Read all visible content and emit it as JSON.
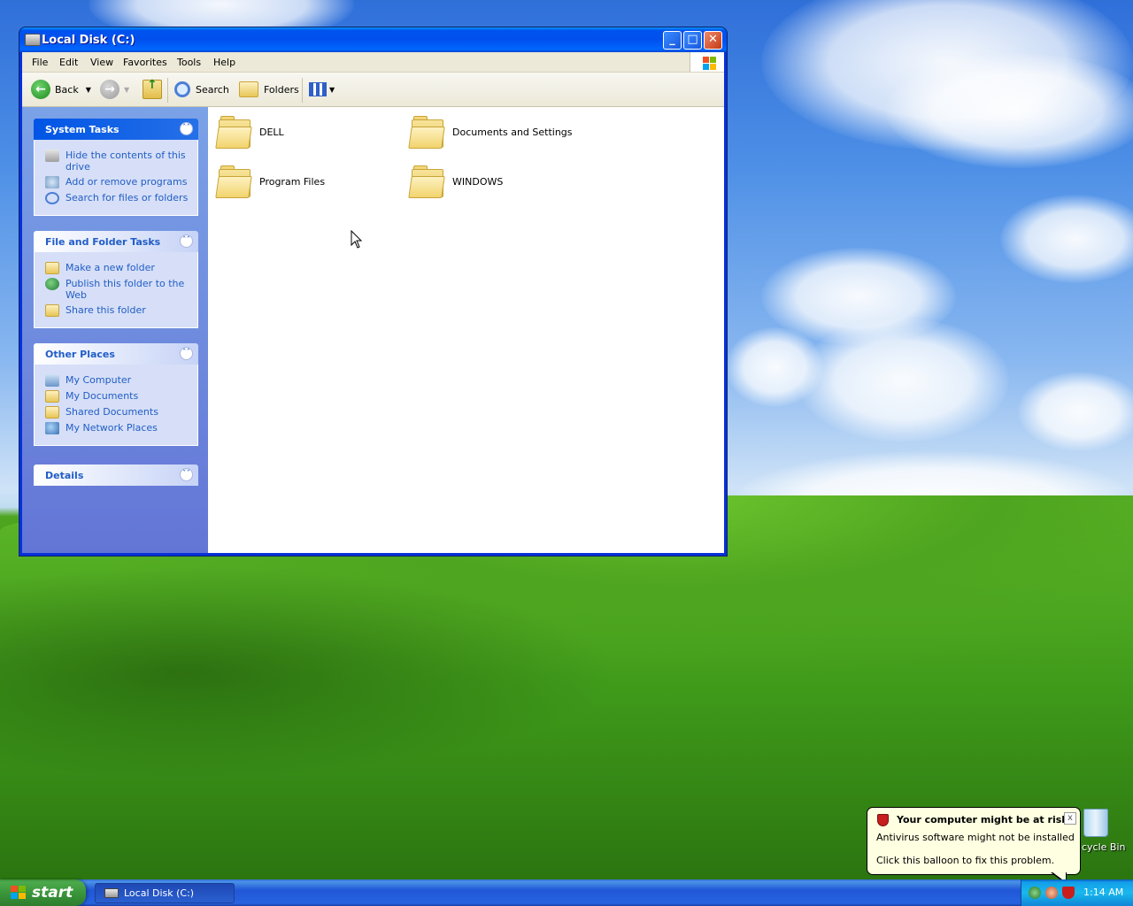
{
  "window": {
    "title": "Local Disk (C:)",
    "minimize_label": "_",
    "maximize_label": "□",
    "close_label": "✕"
  },
  "menu": [
    "File",
    "Edit",
    "View",
    "Favorites",
    "Tools",
    "Help"
  ],
  "toolbar": {
    "back_label": "Back",
    "search_label": "Search",
    "folders_label": "Folders"
  },
  "taskpane": {
    "system_tasks": {
      "title": "System Tasks",
      "items": [
        "Hide the contents of this drive",
        "Add or remove programs",
        "Search for files or folders"
      ]
    },
    "file_folder_tasks": {
      "title": "File and Folder Tasks",
      "items": [
        "Make a new folder",
        "Publish this folder to the Web",
        "Share this folder"
      ]
    },
    "other_places": {
      "title": "Other Places",
      "items": [
        "My Computer",
        "My Documents",
        "Shared Documents",
        "My Network Places"
      ]
    },
    "details": {
      "title": "Details"
    }
  },
  "folders": [
    "DELL",
    "Documents and Settings",
    "Program Files",
    "WINDOWS"
  ],
  "desktop": {
    "recycle_bin_label": "cycle Bin"
  },
  "balloon": {
    "title": "Your computer might be at risk",
    "line1": "Antivirus software might not be installed",
    "line2": "Click this balloon to fix this problem.",
    "close_label": "x"
  },
  "taskbar": {
    "start_label": "start",
    "task_button_label": "Local Disk (C:)",
    "clock": "1:14 AM"
  },
  "colors": {
    "xp_blue": "#0053ee",
    "link_blue": "#215dc6",
    "start_green": "#379137",
    "balloon_bg": "#ffffe1"
  }
}
